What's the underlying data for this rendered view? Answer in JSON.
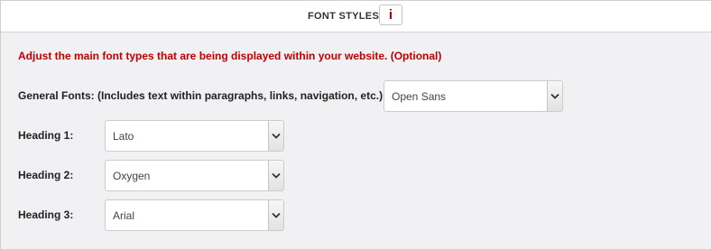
{
  "header": {
    "title": "FONT STYLES",
    "info_icon": "i"
  },
  "intro": "Adjust the main font types that are being displayed within your website. (Optional)",
  "fields": [
    {
      "label": "General Fonts: (Includes text within paragraphs, links, navigation, etc.)",
      "value": "Open Sans"
    },
    {
      "label": "Heading 1:",
      "value": "Lato"
    },
    {
      "label": "Heading 2:",
      "value": "Oxygen"
    },
    {
      "label": "Heading 3:",
      "value": "Arial"
    }
  ],
  "icons": {
    "info": "info-icon",
    "dropdown": "chevron-down-icon"
  },
  "colors": {
    "accent_red": "#c00000",
    "panel_background": "#f1f1f4",
    "header_background": "#ffffff"
  }
}
